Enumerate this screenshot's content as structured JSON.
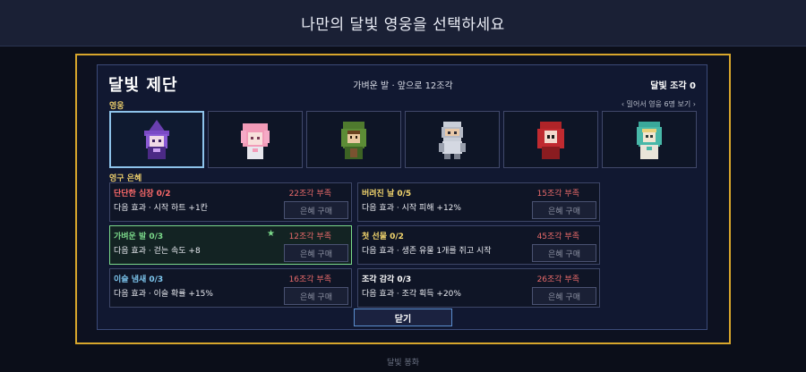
{
  "header": {
    "title": "나만의 달빛 영웅을 선택하세요"
  },
  "dialog": {
    "title": "달빛 제단",
    "subtitle": "가벼운 발 · 앞으로 12조각",
    "shards_label": "달빛 조각 0",
    "heroes_label": "영웅",
    "more_heroes_link": "‹ 밀어서 영웅 6명 보기 ›",
    "blessings_label": "영구 은혜",
    "heroes": [
      {
        "name": "purple-witch",
        "selected": true
      },
      {
        "name": "pink-girl",
        "selected": false
      },
      {
        "name": "green-hood",
        "selected": false
      },
      {
        "name": "knight",
        "selected": false
      },
      {
        "name": "red-hood",
        "selected": false
      },
      {
        "name": "teal-hood",
        "selected": false
      }
    ],
    "blessings": [
      {
        "name": "단단한 심장  0/2",
        "name_color": "#ff6b6b",
        "cost": "22조각 부족",
        "effect": "다음 효과 · 시작 하트 +1칸",
        "button": "은혜 구매",
        "active": false
      },
      {
        "name": "버려진 날  0/5",
        "name_color": "#f5d76e",
        "cost": "15조각 부족",
        "effect": "다음 효과 · 시작 피해 +12%",
        "button": "은혜 구매",
        "active": false
      },
      {
        "name": "가벼운 발  0/3",
        "name_color": "#7bd98a",
        "cost": "12조각 부족",
        "effect": "다음 효과 · 걷는 속도 +8",
        "button": "은혜 구매",
        "active": true,
        "marker": "★"
      },
      {
        "name": "첫 선물  0/2",
        "name_color": "#f5d76e",
        "cost": "45조각 부족",
        "effect": "다음 효과 · 생존 유물 1개를 쥐고 시작",
        "button": "은혜 구매",
        "active": false
      },
      {
        "name": "이슬 냄새  0/3",
        "name_color": "#7ec8f0",
        "cost": "16조각 부족",
        "effect": "다음 효과 · 이슬 확률 +15%",
        "button": "은혜 구매",
        "active": false
      },
      {
        "name": "조각 감각  0/3",
        "name_color": "#ffffff",
        "cost": "26조각 부족",
        "effect": "다음 효과 · 조각 획득 +20%",
        "button": "은혜 구매",
        "active": false
      }
    ],
    "close_label": "닫기"
  },
  "footer": {
    "text": "달빛 봉화"
  }
}
